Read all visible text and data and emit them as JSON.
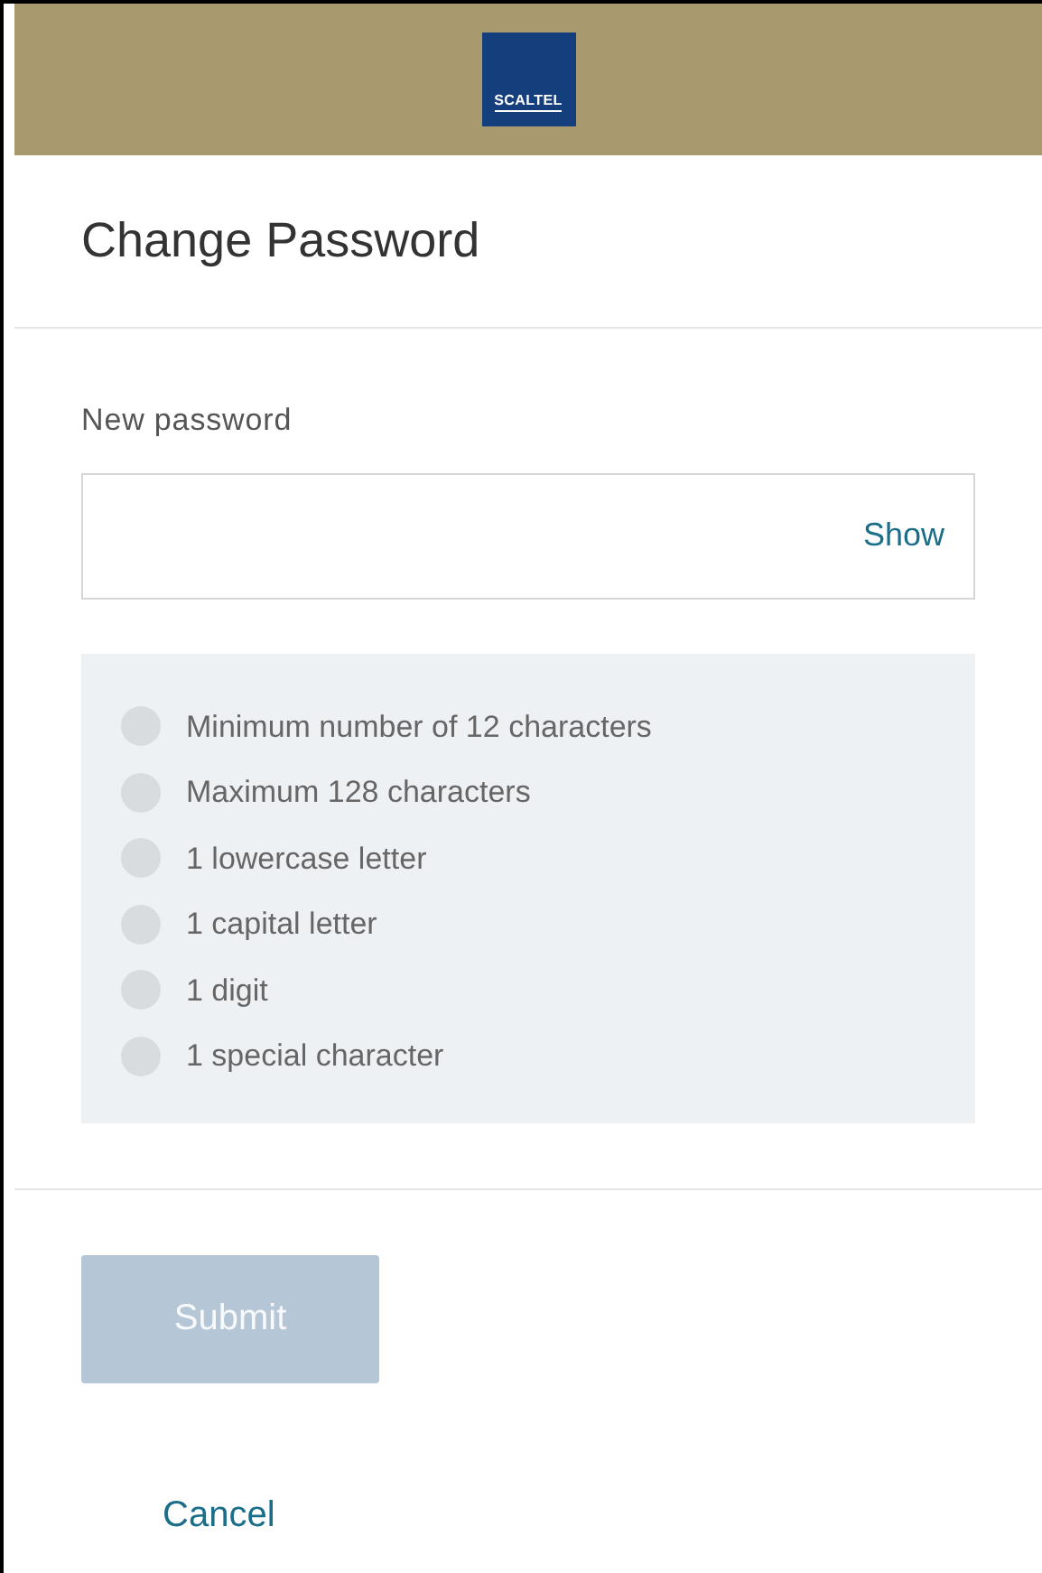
{
  "header": {
    "logo": "SCALTEL"
  },
  "title": "Change Password",
  "field": {
    "label": "New password",
    "toggle": "Show"
  },
  "requirements": [
    {
      "text": "Minimum number of 12 characters",
      "met": false
    },
    {
      "text": "Maximum 128 characters",
      "met": false
    },
    {
      "text": "1 lowercase letter",
      "met": false
    },
    {
      "text": "1 capital letter",
      "met": false
    },
    {
      "text": "1 digit",
      "met": false
    },
    {
      "text": "1 special character",
      "met": false
    }
  ],
  "submit": {
    "label": "Submit",
    "disabled": true
  },
  "cancel": "Cancel"
}
